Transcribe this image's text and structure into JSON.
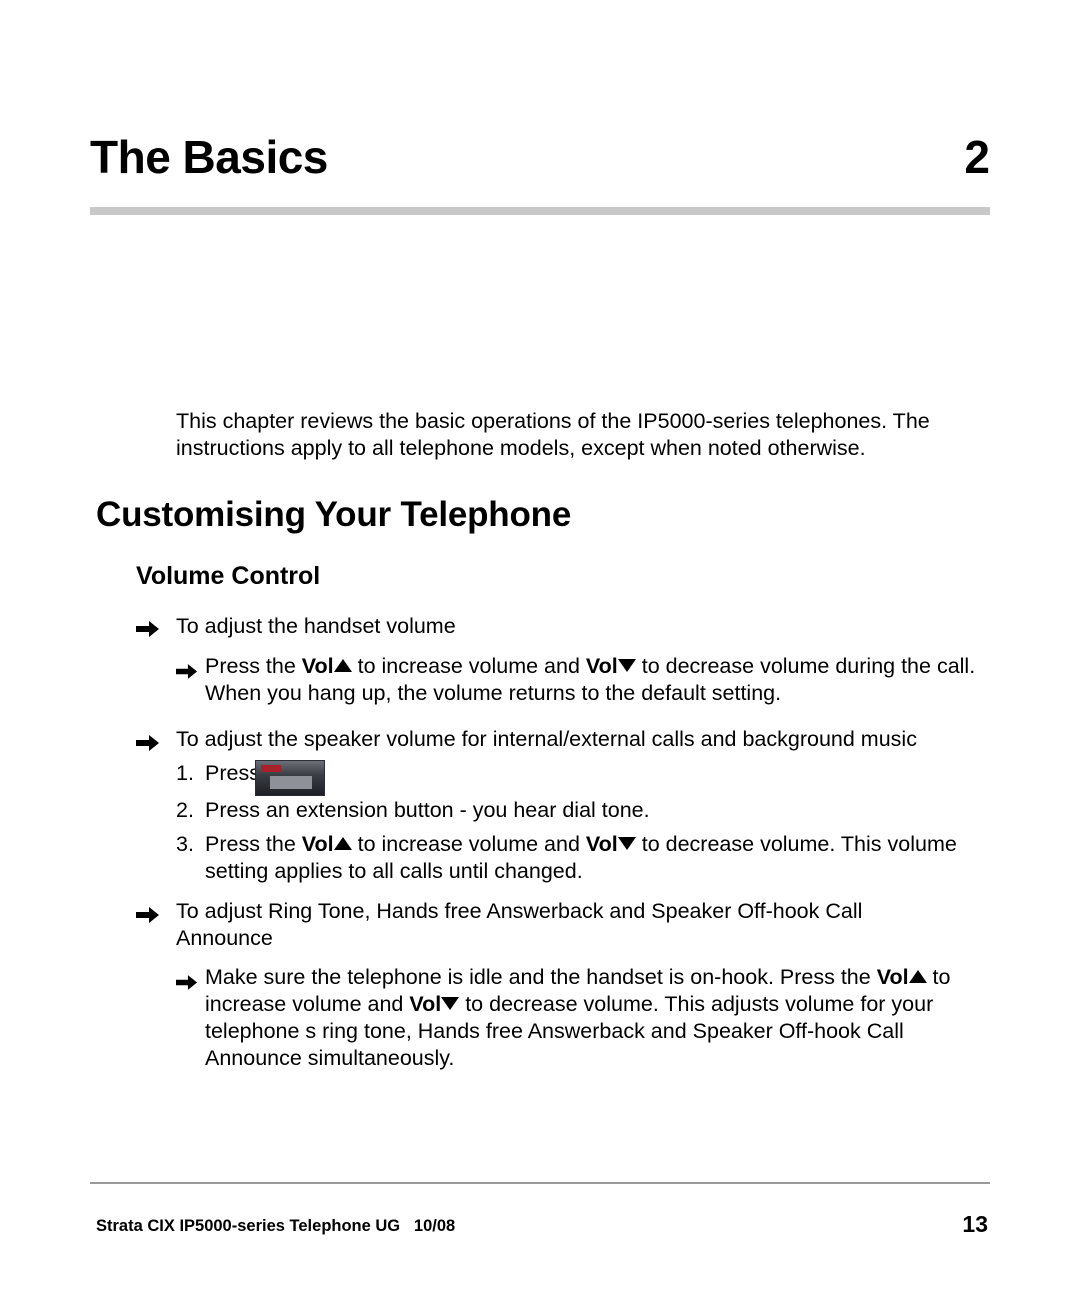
{
  "document": {
    "chapter": {
      "title": "The Basics",
      "number": "2"
    },
    "intro": {
      "line1": "This chapter reviews the basic operations of the IP5000-series telephones. The",
      "line2": "instructions apply to all telephone models, except when noted otherwise."
    },
    "h1": "Customising Your Telephone",
    "h2": "Volume Control",
    "sections": {
      "handset": {
        "heading": "To adjust the handset volume",
        "step_line1_a": "Press the ",
        "step_line1_vol1": "Vol",
        "step_line1_b": " to increase volume and ",
        "step_line1_vol2": "Vol",
        "step_line1_c": " to decrease volume during the call.",
        "step_line2": "When you hang up, the volume returns to the default setting."
      },
      "speaker": {
        "heading": "To adjust the speaker volume for internal/external calls and background music",
        "steps": [
          {
            "number": "1.",
            "text": "Press"
          },
          {
            "number": "2.",
            "text": "Press an extension button - you hear dial tone."
          },
          {
            "number": "3.",
            "text": ""
          }
        ],
        "step3_a": "Press the ",
        "step3_vol1": "Vol",
        "step3_b": " to increase volume and ",
        "step3_vol2": "Vol",
        "step3_c": " to decrease volume. This volume",
        "step3_line2": "setting applies to all calls until changed."
      },
      "ringtone": {
        "heading_line1": "To adjust Ring Tone, Hands free Answerback and Speaker Off-hook Call",
        "heading_line2": "Announce",
        "body_line1_a": "Make sure the telephone is idle and the handset is on-hook. Press the ",
        "body_line1_vol": "Vol",
        "body_line1_b": " to",
        "body_line2_a": "increase volume and ",
        "body_line2_vol": "Vol",
        "body_line2_b": " to decrease volume. This adjusts volume for your",
        "body_line3": "telephone s ring tone, Hands free Answerback and Speaker Off-hook Call",
        "body_line4": "Announce simultaneously."
      }
    },
    "footer": {
      "left": "Strata CIX IP5000-series Telephone UG",
      "date": "10/08",
      "page_number": "13"
    },
    "key_image": {
      "name": "spkr-button-image"
    },
    "colors": {
      "rule": "#c8c8c8",
      "footer_rule": "#9a9a9a",
      "text": "#000000"
    }
  }
}
